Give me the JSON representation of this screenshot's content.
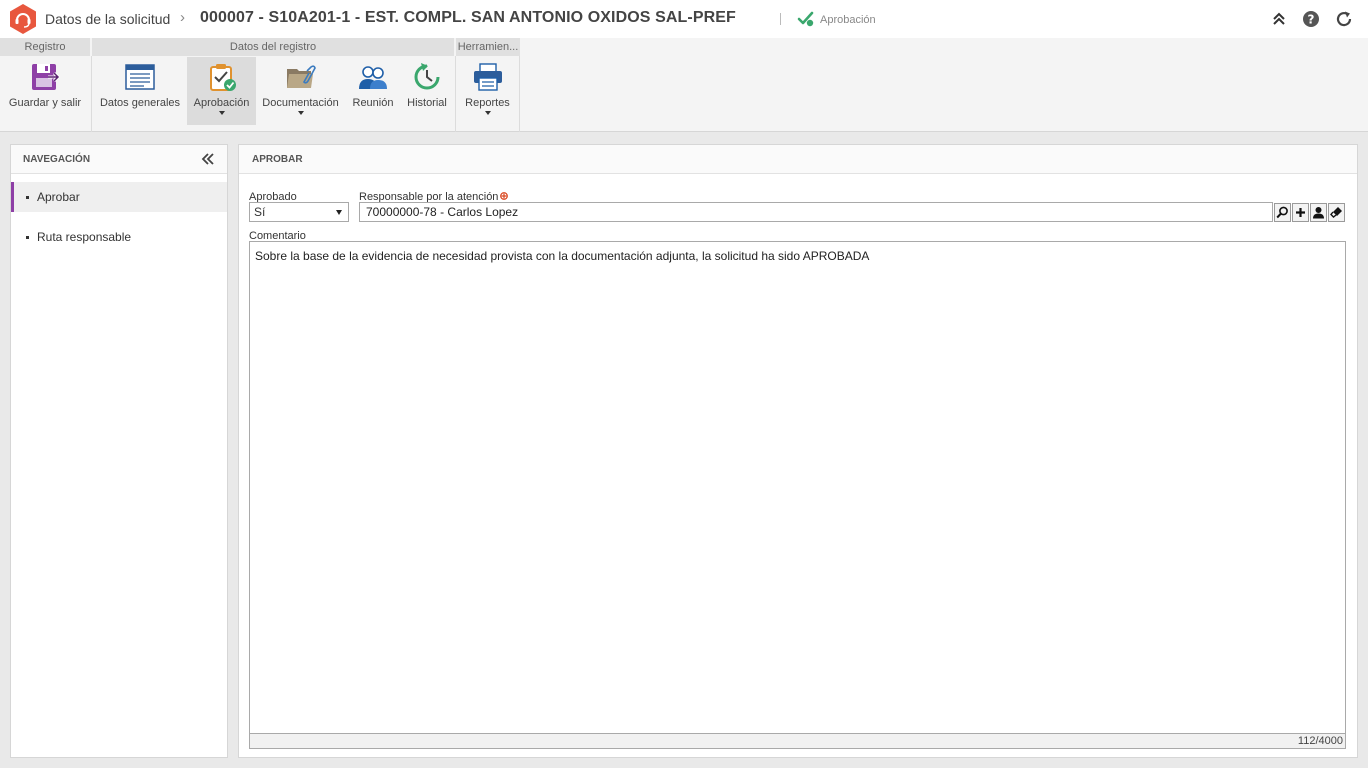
{
  "header": {
    "breadcrumb_root": "Datos de la solicitud",
    "breadcrumb_separator": "›",
    "title": "000007 - S10A201-1 - EST. COMPL. SAN ANTONIO OXIDOS SAL-PREF",
    "status": "Aprobación",
    "accent_color": "#e8573e",
    "icons": [
      "collapse-up-icon",
      "help-icon",
      "refresh-icon"
    ]
  },
  "ribbon": {
    "groups": [
      {
        "label": "Registro"
      },
      {
        "label": "Datos del registro"
      },
      {
        "label": "Herramien..."
      }
    ],
    "buttons": {
      "save": {
        "label": "Guardar y salir",
        "icon": "save-exit-icon"
      },
      "general": {
        "label": "Datos generales",
        "icon": "general-data-icon"
      },
      "approval": {
        "label": "Aprobación",
        "icon": "approval-icon"
      },
      "documentation": {
        "label": "Documentación",
        "icon": "documentation-icon"
      },
      "meeting": {
        "label": "Reunión",
        "icon": "meeting-icon"
      },
      "history": {
        "label": "Historial",
        "icon": "history-icon"
      },
      "reports": {
        "label": "Reportes",
        "icon": "printer-icon"
      }
    }
  },
  "navigation": {
    "title": "NAVEGACIÓN",
    "items": [
      {
        "label": "Aprobar",
        "selected": true
      },
      {
        "label": "Ruta responsable",
        "selected": false
      }
    ],
    "selected_color": "#8e3fa6"
  },
  "main": {
    "title": "APROBAR",
    "approved": {
      "label": "Aprobado",
      "value": "Sí"
    },
    "responsible": {
      "label": "Responsable por la atención",
      "value": "70000000-78 - Carlos Lopez"
    },
    "comment": {
      "label": "Comentario",
      "value": "Sobre la base de la evidencia de necesidad provista con la documentación adjunta, la solicitud ha sido APROBADA",
      "counter": "112/4000"
    }
  }
}
